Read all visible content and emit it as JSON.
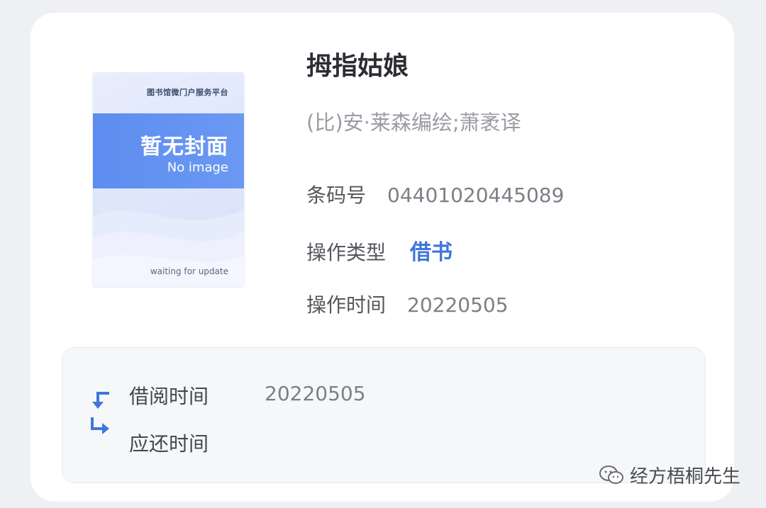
{
  "cover": {
    "platform": "图书馆微门户服务平台",
    "title": "暂无封面",
    "subtitle": "No image",
    "waiting": "waiting for update"
  },
  "book": {
    "title": "拇指姑娘",
    "author": "(比)安·莱森编绘;萧袤译"
  },
  "details": {
    "barcode_label": "条码号",
    "barcode_value": "04401020445089",
    "op_type_label": "操作类型",
    "op_type_value": "借书",
    "op_time_label": "操作时间",
    "op_time_value": "20220505"
  },
  "borrow": {
    "borrow_label": "借阅时间",
    "borrow_value": "20220505",
    "due_label": "应还时间"
  },
  "watermark": "经方梧桐先生",
  "colors": {
    "accent": "#3f76d9",
    "cover_band": "#5d8df0",
    "background": "#eff0f3"
  }
}
